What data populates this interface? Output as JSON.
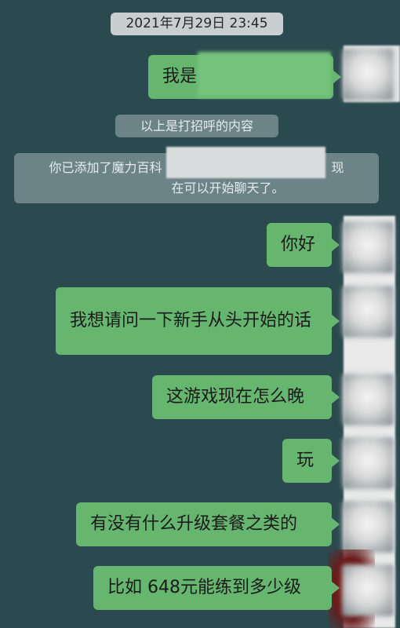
{
  "timestamp": "2021年7月29日 23:45",
  "hint": "以上是打招呼的内容",
  "system_message": {
    "line1_prefix": "你已添加了魔力百科",
    "line1_suffix": "，现",
    "line2": "在可以开始聊天了。"
  },
  "messages": [
    {
      "text": "我是"
    },
    {
      "text": "你好"
    },
    {
      "text": "我想请问一下新手从头开始的话"
    },
    {
      "text": "这游戏现在怎么晚"
    },
    {
      "text": "玩"
    },
    {
      "text": "有没有什么升级套餐之类的"
    },
    {
      "text": "比如 648元能练到多少级"
    }
  ],
  "colors": {
    "background": "#2b4a50",
    "bubble": "#67b670",
    "system_pill": "#6c8387",
    "timestamp_pill": "#c9cfd0"
  }
}
